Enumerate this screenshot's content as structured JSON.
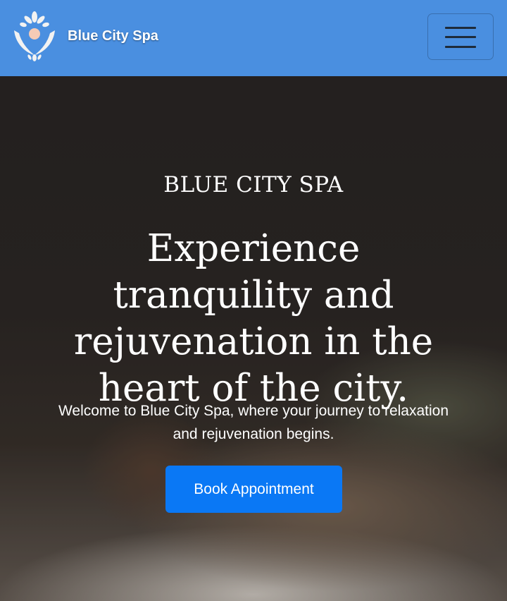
{
  "navbar": {
    "brand_name": "Blue City Spa",
    "logo_icon": "lotus-figure-icon",
    "menu_icon": "hamburger-menu-icon",
    "background_color": "#4a8fe0"
  },
  "hero": {
    "eyebrow": "BLUE CITY SPA",
    "headline": "Experience tranquility and rejuvenation in the heart of the city.",
    "subtext": "Welcome to Blue City Spa, where your journey to relaxation and rejuvenation begins.",
    "cta_label": "Book Appointment",
    "cta_color": "#0a78f5",
    "background_image": "woman-relaxing-on-massage-table"
  }
}
